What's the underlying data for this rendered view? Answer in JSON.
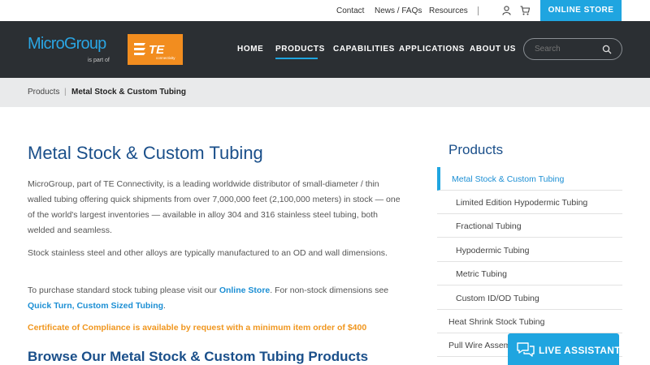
{
  "utility": {
    "links": [
      "Contact",
      "News / FAQs",
      "Resources"
    ],
    "online_store": "ONLINE STORE"
  },
  "brand": {
    "name": "MicroGroup",
    "tagline": "is part of",
    "partner": "TE",
    "partner_sub": "connectivity",
    "accent_color": "#1fa5e0",
    "partner_color": "#f28d1f"
  },
  "nav": {
    "items": [
      "HOME",
      "PRODUCTS",
      "CAPABILITIES",
      "APPLICATIONS",
      "ABOUT US"
    ],
    "active": "PRODUCTS",
    "search_placeholder": "Search"
  },
  "breadcrumb": {
    "items": [
      "Products",
      "Metal Stock & Custom Tubing"
    ],
    "separator": "|"
  },
  "main": {
    "title": "Metal Stock & Custom Tubing",
    "p1": "MicroGroup, part of TE Connectivity, is a leading worldwide distributor of small-diameter / thin walled tubing offering quick shipments from over 7,000,000 feet (2,100,000 meters) in stock — one of the world's largest inventories — available in alloy 304 and 316 stainless steel tubing, both welded and seamless.",
    "p2": "Stock stainless steel and other alloys are typically manufactured to an OD and wall dimensions.",
    "p3_before": "To purchase standard stock tubing please visit our ",
    "p3_link1": "Online Store",
    "p3_middle": ". For non-stock dimensions see ",
    "p3_link2": "Quick Turn, Custom Sized Tubing",
    "p3_after": ".",
    "certificate": "Certificate of Compliance is available by request with a minimum item order of $400",
    "browse_heading": "Browse Our Metal Stock & Custom Tubing Products"
  },
  "sidebar": {
    "title": "Products",
    "items": [
      {
        "label": "Metal Stock & Custom Tubing",
        "level": "top",
        "active": true
      },
      {
        "label": "Limited Edition Hypodermic Tubing",
        "level": "sub"
      },
      {
        "label": "Fractional Tubing",
        "level": "sub"
      },
      {
        "label": "Hypodermic Tubing",
        "level": "sub"
      },
      {
        "label": "Metric Tubing",
        "level": "sub"
      },
      {
        "label": "Custom ID/OD Tubing",
        "level": "sub"
      },
      {
        "label": "Heat Shrink Stock Tubing",
        "level": "top"
      },
      {
        "label": "Pull Wire Assemblies",
        "level": "top"
      }
    ]
  },
  "live_assistant": {
    "label": "LIVE ASSISTANT"
  }
}
